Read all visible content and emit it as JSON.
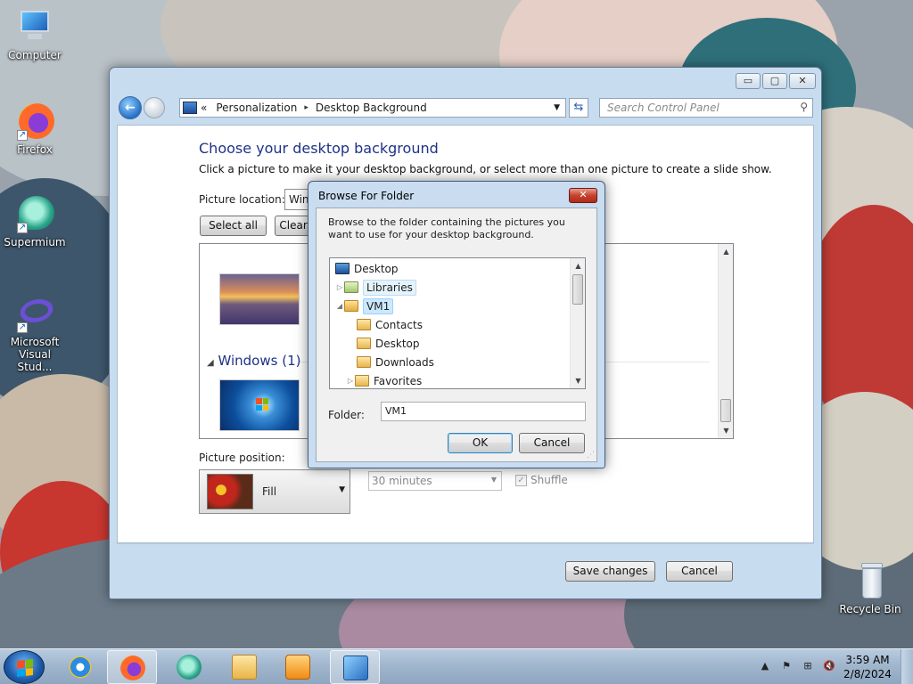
{
  "desktop": {
    "icons": [
      {
        "label": "Computer"
      },
      {
        "label": "Firefox"
      },
      {
        "label": "Supermium"
      },
      {
        "label": "Microsoft Visual Stud..."
      },
      {
        "label": "Recycle Bin"
      }
    ]
  },
  "window": {
    "controls": {
      "minimize": "▭",
      "maximize": "▢",
      "close": "✕"
    },
    "nav": {
      "back": "←",
      "breadcrumb": [
        "Personalization",
        "Desktop Background"
      ],
      "chevrons": "«",
      "separator": "▸",
      "search_placeholder": "Search Control Panel"
    },
    "heading": "Choose your desktop background",
    "subtitle": "Click a picture to make it your desktop background, or select more than one picture to create a slide show.",
    "picture_location_label": "Picture location:",
    "picture_location_value": "Windows Desktop Backgrounds",
    "select_all": "Select all",
    "clear_all": "Clear all",
    "group_header": "Windows (1)",
    "picture_position_label": "Picture position:",
    "picture_position_value": "Fill",
    "interval_value": "30 minutes",
    "shuffle_label": "Shuffle",
    "shuffle_checked": true,
    "save_changes": "Save changes",
    "cancel": "Cancel"
  },
  "dialog": {
    "title": "Browse For Folder",
    "close": "✕",
    "description": "Browse to the folder containing the pictures you want to use for your desktop background.",
    "tree": [
      {
        "label": "Desktop",
        "level": 0,
        "state": "none"
      },
      {
        "label": "Libraries",
        "level": 1,
        "state": "collapsed"
      },
      {
        "label": "VM1",
        "level": 1,
        "state": "expanded"
      },
      {
        "label": "Contacts",
        "level": 2,
        "state": "none"
      },
      {
        "label": "Desktop",
        "level": 2,
        "state": "none"
      },
      {
        "label": "Downloads",
        "level": 2,
        "state": "none"
      },
      {
        "label": "Favorites",
        "level": 2,
        "state": "collapsed"
      }
    ],
    "folder_label": "Folder:",
    "folder_value": "VM1",
    "ok": "OK",
    "cancel": "Cancel"
  },
  "taskbar": {
    "clock_time": "3:59 AM",
    "clock_date": "2/8/2024"
  },
  "colors": {
    "accent_heading": "#1e3287",
    "selection": "#cce8ff"
  }
}
